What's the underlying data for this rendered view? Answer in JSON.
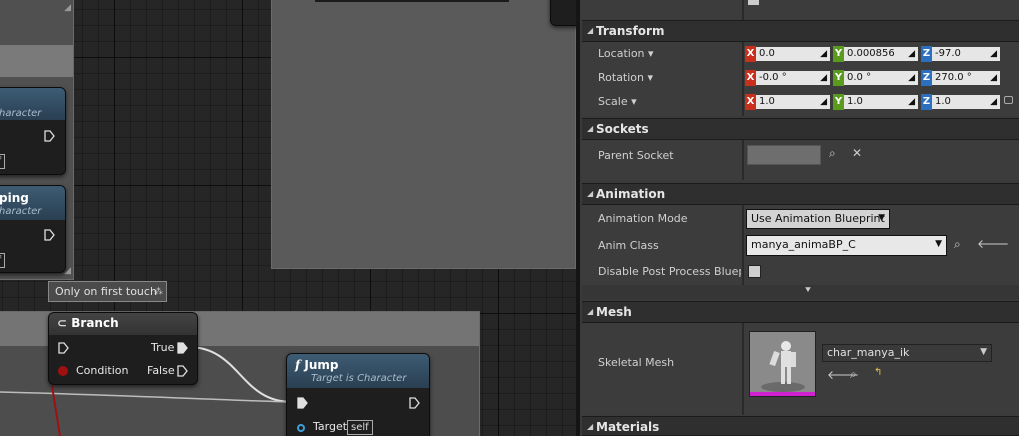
{
  "graph": {
    "tooltip": "Only on first touch",
    "left_node_1": {
      "subtitle": "haracter",
      "pin": "lf"
    },
    "left_node_2": {
      "title": "ping",
      "subtitle": "haracter",
      "pin": "lf"
    },
    "branch": {
      "title": "Branch",
      "true_label": "True",
      "condition_label": "Condition",
      "false_label": "False"
    },
    "jump": {
      "title": "Jump",
      "subtitle": "Target is Character",
      "target_label": "Target",
      "self_label": "self"
    }
  },
  "details": {
    "transform": {
      "title": "Transform",
      "location": {
        "label": "Location",
        "x": "0.0",
        "y": "0.000856",
        "z": "-97.0"
      },
      "rotation": {
        "label": "Rotation",
        "x": "-0.0 °",
        "y": "0.0 °",
        "z": "270.0 °"
      },
      "scale": {
        "label": "Scale",
        "x": "1.0",
        "y": "1.0",
        "z": "1.0"
      }
    },
    "sockets": {
      "title": "Sockets",
      "parent_socket_label": "Parent Socket"
    },
    "animation": {
      "title": "Animation",
      "mode_label": "Animation Mode",
      "mode_value": "Use Animation Blueprint",
      "anim_class_label": "Anim Class",
      "anim_class_value": "manya_animaBP_C",
      "disable_pp_label": "Disable Post Process Blueprint"
    },
    "mesh": {
      "title": "Mesh",
      "skeletal_mesh_label": "Skeletal Mesh",
      "skeletal_mesh_value": "char_manya_ik"
    },
    "materials": {
      "title": "Materials"
    }
  },
  "colors": {
    "axis_x": "#c8301e",
    "axis_y": "#5a9a1c",
    "axis_z": "#2c6fbf",
    "node_header": "#34506a",
    "exec_wire": "#e0e0e0",
    "bool_pin": "#a01010"
  }
}
